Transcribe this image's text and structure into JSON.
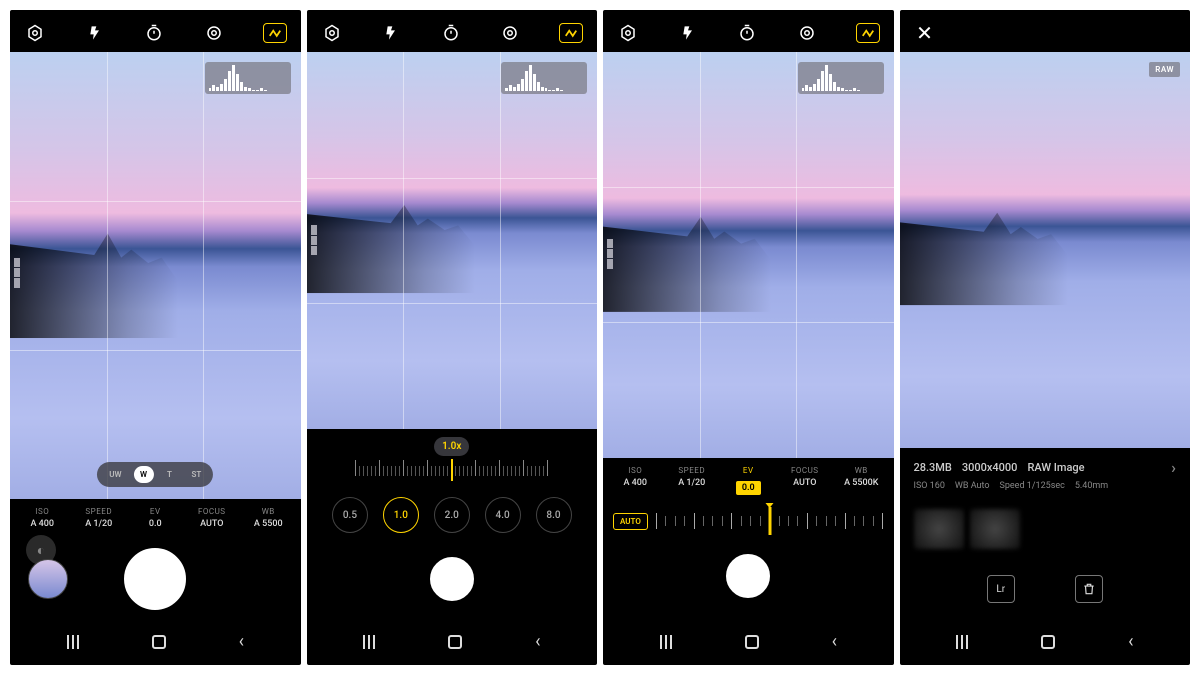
{
  "colors": {
    "accent": "#ffd400"
  },
  "top_icons": {
    "settings": "settings",
    "flash": "flash",
    "timer": "timer",
    "ratio": "ratio",
    "raw": "raw-toggle"
  },
  "histogram_heights": [
    2,
    4,
    3,
    5,
    8,
    14,
    18,
    12,
    6,
    3,
    2,
    1,
    1,
    2,
    1,
    0,
    0,
    0,
    0,
    0
  ],
  "screen1": {
    "lens_options": [
      "UW",
      "W",
      "T",
      "ST"
    ],
    "lens_selected_index": 1,
    "params": {
      "iso": {
        "label": "ISO",
        "value": "A 400"
      },
      "speed": {
        "label": "SPEED",
        "value": "A 1/20"
      },
      "ev": {
        "label": "EV",
        "value": "0.0"
      },
      "focus": {
        "label": "FOCUS",
        "value": "AUTO"
      },
      "wb": {
        "label": "WB",
        "value": "A 5500"
      }
    }
  },
  "screen2": {
    "zoom_current": "1.0x",
    "zoom_presets": [
      "0.5",
      "1.0",
      "2.0",
      "4.0",
      "8.0"
    ],
    "zoom_selected_index": 1
  },
  "screen3": {
    "params": {
      "iso": {
        "label": "ISO",
        "value": "A 400"
      },
      "speed": {
        "label": "SPEED",
        "value": "A 1/20"
      },
      "ev": {
        "label": "EV",
        "value": "0.0"
      },
      "focus": {
        "label": "FOCUS",
        "value": "AUTO"
      },
      "wb": {
        "label": "WB",
        "value": "A 5500K"
      }
    },
    "auto_label": "AUTO"
  },
  "screen4": {
    "raw_badge": "RAW",
    "review": {
      "size": "28.3MB",
      "dimensions": "3000x4000",
      "type": "RAW Image",
      "iso": "ISO 160",
      "wb": "WB Auto",
      "speed": "Speed 1/125sec",
      "focal": "5.40mm"
    },
    "action_lightroom": "Lr"
  }
}
